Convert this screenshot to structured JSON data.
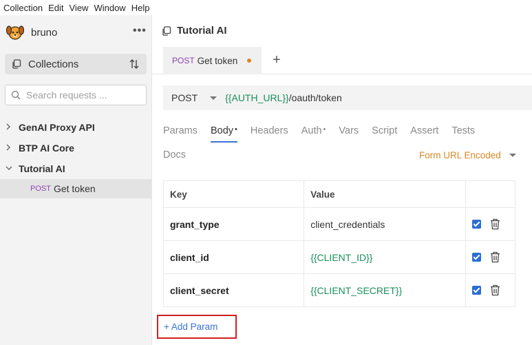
{
  "menu": [
    "Collection",
    "Edit",
    "View",
    "Window",
    "Help"
  ],
  "sidebar": {
    "brand": "bruno",
    "collections_label": "Collections",
    "search_placeholder": "Search requests ...",
    "collections": [
      {
        "label": "GenAI Proxy API",
        "expanded": false
      },
      {
        "label": "BTP AI Core",
        "expanded": false
      },
      {
        "label": "Tutorial AI",
        "expanded": true
      }
    ],
    "request": {
      "method": "POST",
      "label": "Get token"
    }
  },
  "main": {
    "title": "Tutorial AI",
    "tab": {
      "method": "POST",
      "label": "Get token",
      "unsaved": true
    },
    "url": {
      "method": "POST",
      "var": "{{AUTH_URL}}",
      "path": "/oauth/token"
    },
    "subtabs": [
      {
        "label": "Params",
        "mark": ""
      },
      {
        "label": "Body",
        "mark": "•"
      },
      {
        "label": "Headers",
        "mark": ""
      },
      {
        "label": "Auth",
        "mark": "•"
      },
      {
        "label": "Vars",
        "mark": ""
      },
      {
        "label": "Script",
        "mark": ""
      },
      {
        "label": "Assert",
        "mark": ""
      },
      {
        "label": "Tests",
        "mark": ""
      }
    ],
    "docs_label": "Docs",
    "body_mode": "Form URL Encoded",
    "table": {
      "headers": {
        "key": "Key",
        "value": "Value"
      },
      "rows": [
        {
          "key": "grant_type",
          "value": "client_credentials",
          "is_var": false,
          "enabled": true
        },
        {
          "key": "client_id",
          "value": "{{CLIENT_ID}}",
          "is_var": true,
          "enabled": true
        },
        {
          "key": "client_secret",
          "value": "{{CLIENT_SECRET}}",
          "is_var": true,
          "enabled": true
        }
      ]
    },
    "add_param": "+ Add Param"
  },
  "colors": {
    "accent": "#3b73d6",
    "method": "#8e44ad",
    "variable": "#1a8f5a",
    "highlight": "#d11f1f",
    "orange": "#d98727"
  }
}
